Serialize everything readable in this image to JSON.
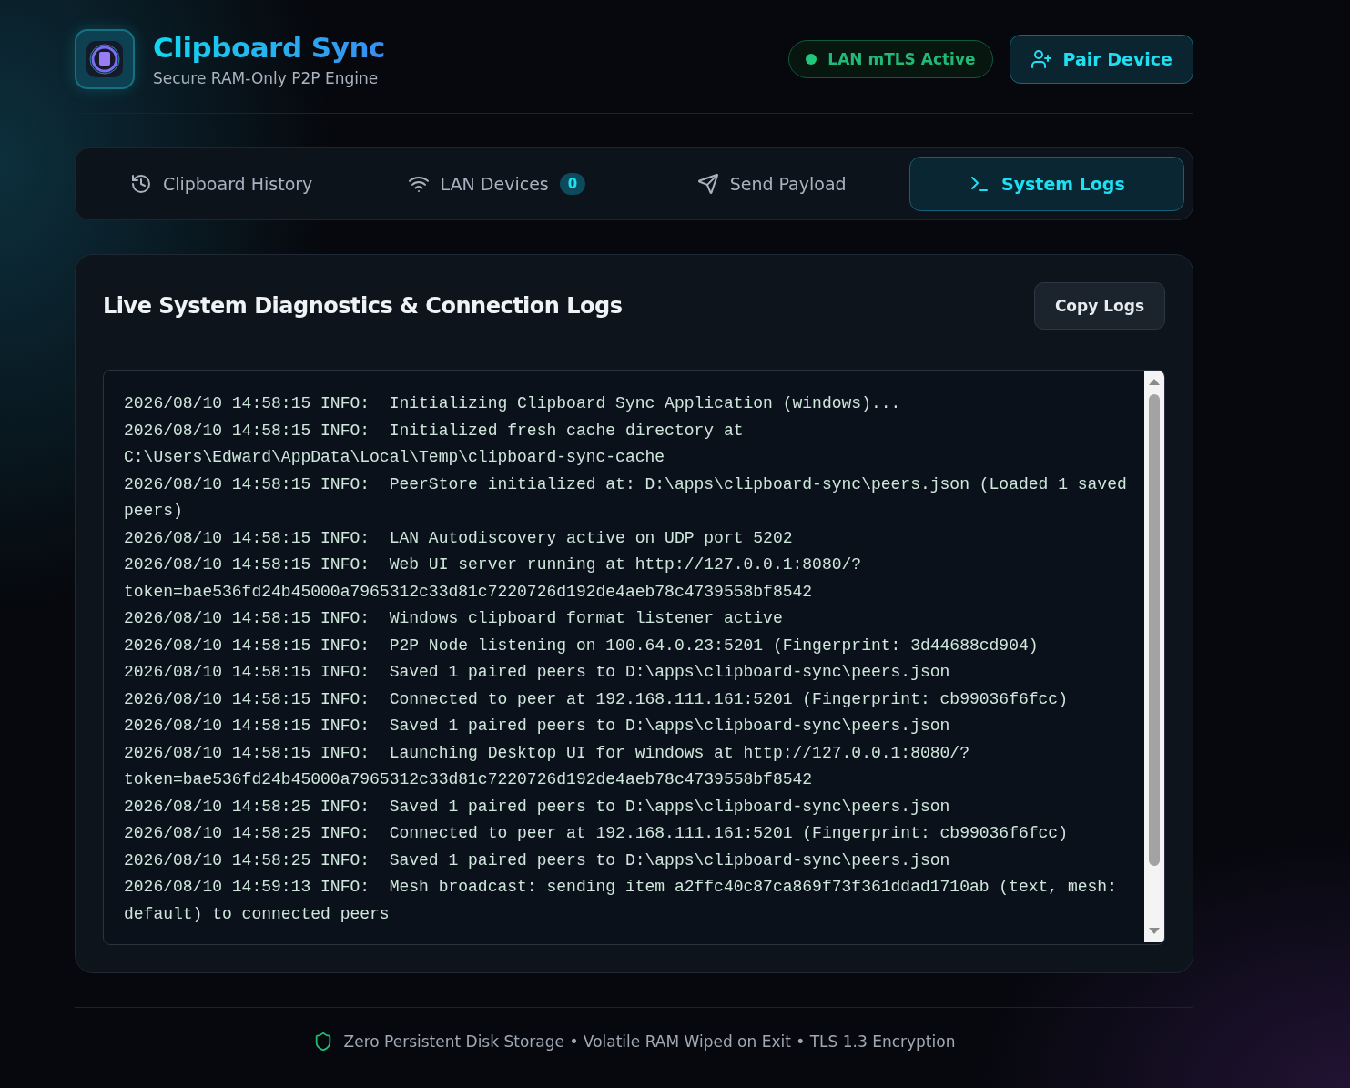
{
  "header": {
    "title": "Clipboard Sync",
    "subtitle": "Secure RAM-Only P2P Engine",
    "status": {
      "label": "LAN mTLS Active",
      "color": "#22c77a"
    },
    "pair_button": "Pair Device"
  },
  "tabs": [
    {
      "kind": "history",
      "label": "Clipboard History",
      "selected": false
    },
    {
      "kind": "devices",
      "label": "LAN Devices",
      "badge": "0",
      "selected": false
    },
    {
      "kind": "send",
      "label": "Send Payload",
      "selected": false
    },
    {
      "kind": "logs",
      "label": "System Logs",
      "selected": true
    }
  ],
  "panel": {
    "title": "Live System Diagnostics & Connection Logs",
    "copy_button": "Copy Logs",
    "logs": [
      "2026/08/10 14:58:15 INFO:  Initializing Clipboard Sync Application (windows)...",
      "2026/08/10 14:58:15 INFO:  Initialized fresh cache directory at C:\\Users\\Edward\\AppData\\Local\\Temp\\clipboard-sync-cache",
      "2026/08/10 14:58:15 INFO:  PeerStore initialized at: D:\\apps\\clipboard-sync\\peers.json (Loaded 1 saved peers)",
      "2026/08/10 14:58:15 INFO:  LAN Autodiscovery active on UDP port 5202",
      "2026/08/10 14:58:15 INFO:  Web UI server running at http://127.0.0.1:8080/?token=bae536fd24b45000a7965312c33d81c7220726d192de4aeb78c4739558bf8542",
      "2026/08/10 14:58:15 INFO:  Windows clipboard format listener active",
      "2026/08/10 14:58:15 INFO:  P2P Node listening on 100.64.0.23:5201 (Fingerprint: 3d44688cd904)",
      "2026/08/10 14:58:15 INFO:  Saved 1 paired peers to D:\\apps\\clipboard-sync\\peers.json",
      "2026/08/10 14:58:15 INFO:  Connected to peer at 192.168.111.161:5201 (Fingerprint: cb99036f6fcc)",
      "2026/08/10 14:58:15 INFO:  Saved 1 paired peers to D:\\apps\\clipboard-sync\\peers.json",
      "2026/08/10 14:58:15 INFO:  Launching Desktop UI for windows at http://127.0.0.1:8080/?token=bae536fd24b45000a7965312c33d81c7220726d192de4aeb78c4739558bf8542",
      "2026/08/10 14:58:25 INFO:  Saved 1 paired peers to D:\\apps\\clipboard-sync\\peers.json",
      "2026/08/10 14:58:25 INFO:  Connected to peer at 192.168.111.161:5201 (Fingerprint: cb99036f6fcc)",
      "2026/08/10 14:58:25 INFO:  Saved 1 paired peers to D:\\apps\\clipboard-sync\\peers.json",
      "2026/08/10 14:59:13 INFO:  Mesh broadcast: sending item a2ffc40c87ca869f73f361ddad1710ab (text, mesh: default) to connected peers"
    ]
  },
  "footer": "Zero Persistent Disk Storage • Volatile RAM Wiped on Exit • TLS 1.3 Encryption"
}
